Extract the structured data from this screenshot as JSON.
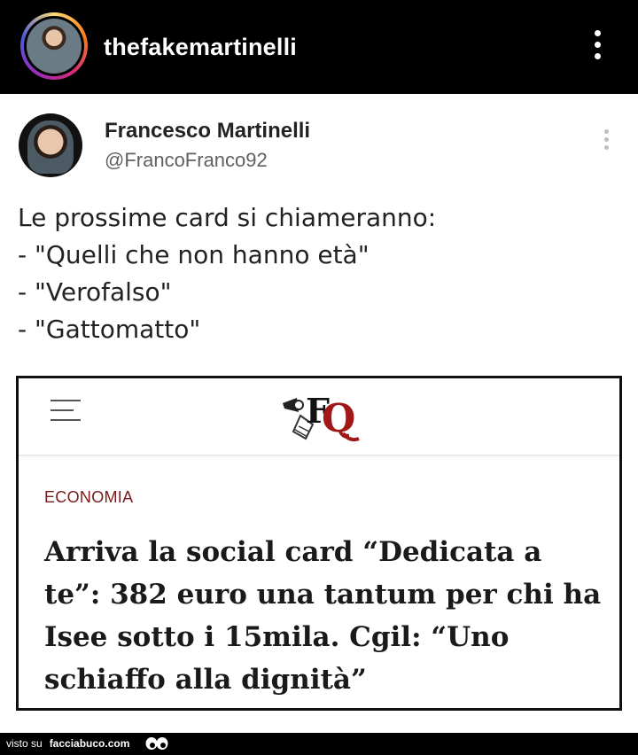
{
  "instagram": {
    "username": "thefakemartinelli"
  },
  "tweet": {
    "author_name": "Francesco Martinelli",
    "author_handle": "@FrancoFranco92",
    "lines": [
      "Le prossime card si chiameranno:",
      "- \"Quelli che non hanno età\"",
      "- \"Verofalso\"",
      "- \"Gattomatto\""
    ]
  },
  "article": {
    "logo_letters": "FQ",
    "section": "ECONOMIA",
    "headline_lines": [
      "Arriva la social card “Dedicata a",
      "te”: 382 euro una tantum per chi ha",
      "Isee sotto i 15mila. Cgil: “Uno",
      "schiaffo alla dignità”"
    ]
  },
  "watermark": {
    "prefix": "visto su",
    "site": "facciabuco.com"
  },
  "colors": {
    "topbar_bg": "#000000",
    "section_label": "#7a1a1a",
    "logo_red": "#a01818"
  }
}
